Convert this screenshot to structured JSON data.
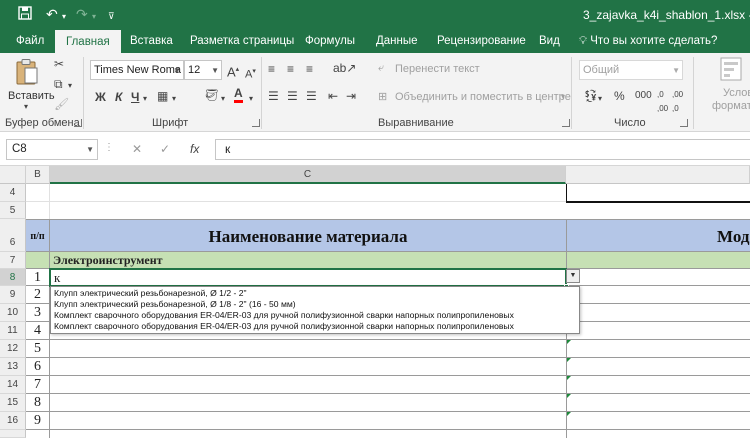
{
  "window": {
    "title": "3_zajavka_k4i_shablon_1.xlsx - Excel"
  },
  "tabs": [
    {
      "label": "Файл"
    },
    {
      "label": "Главная"
    },
    {
      "label": "Вставка"
    },
    {
      "label": "Разметка страницы"
    },
    {
      "label": "Формулы"
    },
    {
      "label": "Данные"
    },
    {
      "label": "Рецензирование"
    },
    {
      "label": "Вид"
    }
  ],
  "tellme": "Что вы хотите сделать?",
  "ribbon": {
    "paste_label": "Вставить",
    "clipboard_label": "Буфер обмена",
    "font_name": "Times New Roma",
    "font_size": "12",
    "bold": "Ж",
    "italic": "К",
    "underline": "Ч",
    "font_group_label": "Шрифт",
    "wrap_text": "Перенести текст",
    "merge_center": "Объединить и поместить в центре",
    "alignment_group_label": "Выравнивание",
    "number_format": "Общий",
    "number_group_label": "Число",
    "cond_format_line1": "Услов",
    "cond_format_line2": "форматир"
  },
  "formula_bar": {
    "name_box": "C8",
    "fx": "fx",
    "formula": "к"
  },
  "grid": {
    "col_headers": [
      "B",
      "C"
    ],
    "row_numbers": [
      "4",
      "5",
      "6",
      "7",
      "8",
      "9",
      "10",
      "11",
      "12",
      "13",
      "14",
      "15",
      "16"
    ],
    "header_row": {
      "col_b": "п/п",
      "col_c": "Наименование материала",
      "col_d": "Мод"
    },
    "category": "Электроинструмент",
    "row_nums": [
      "1",
      "2",
      "3",
      "4",
      "5",
      "6",
      "7",
      "8",
      "9"
    ],
    "active_cell_value": "к"
  },
  "dropdown": {
    "items": [
      "Клупп электрический резьбонарезной,  Ø 1/2 - 2\"",
      "Клупп электрический резьбонарезной, Ø 1/8 - 2\" (16 - 50 мм)",
      "Комплект сварочного оборудования ER-04/ER-03 для ручной полифузионной сварки напорных полипропиленовых",
      "Комплект сварочного оборудования ER-04/ER-03 для ручной полифузионной сварки напорных полипропиленовых"
    ]
  },
  "colors": {
    "excel_green": "#217346",
    "header_blue": "#b4c6e7",
    "category_green": "#c6e0b4",
    "font_color_red": "#ff0000"
  }
}
